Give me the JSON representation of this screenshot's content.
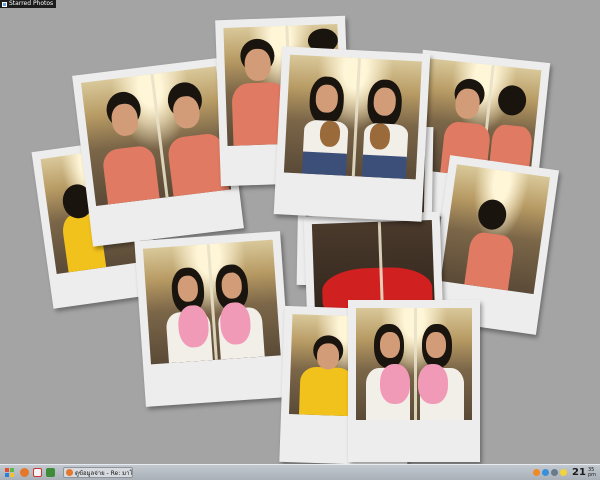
{
  "window": {
    "title": "Starred Photos"
  },
  "taskbar": {
    "task_label": "ดูข้อมูลจ่าย - Re: มาโร...",
    "clock_hour": "21",
    "clock_minute_top": "35",
    "clock_minute_bottom": "pm"
  },
  "colors": {
    "desktop_bg": "#a4a4a4",
    "polaroid_frame": "#ededed",
    "titlebar_bg": "#1c1c1c"
  },
  "icons": [
    "app-icon",
    "windows-start-icon",
    "firefox-icon",
    "gmail-icon",
    "quicklaunch-icon",
    "firefox-task-icon",
    "tray-feed-icon",
    "tray-network-icon",
    "tray-volume-icon",
    "tray-chat-icon"
  ]
}
